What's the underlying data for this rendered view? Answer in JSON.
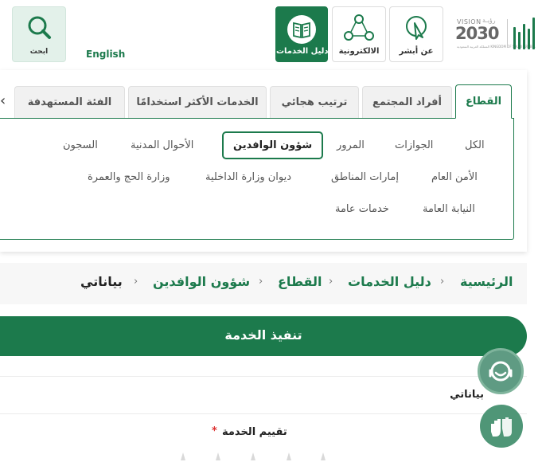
{
  "header": {
    "logo": {
      "vision_en": "VISION",
      "vision_ar": "رؤيـة",
      "year": "2030",
      "ministry": "المملكة العربية السعودية KINGDOM OF SAUDI ARABIA"
    },
    "buttons": [
      {
        "label": "عن أبشر",
        "icon": "pointer-icon"
      },
      {
        "label": "الالكترونية",
        "icon": "share-icon"
      },
      {
        "label": "دليل الخدمات",
        "icon": "book-icon",
        "active": true
      }
    ],
    "search_label": "ابحث",
    "language_link": "English"
  },
  "tabs": [
    {
      "label": "القطاع",
      "active": true
    },
    {
      "label": "أفراد المجتمع"
    },
    {
      "label": "ترتيب هجائي"
    },
    {
      "label": "الخدمات الأكثر استخدامًا"
    },
    {
      "label": "الفئة المستهدفة"
    }
  ],
  "categories": {
    "row1": [
      "الكل",
      "الجوازات",
      "المرور",
      "شؤون الوافدين",
      "الأحوال المدنية",
      "السجون"
    ],
    "row2": [
      "الأمن العام",
      "إمارات المناطق",
      "ديوان وزارة الداخلية",
      "وزارة الحج والعمرة"
    ],
    "row3": [
      "النيابة العامة",
      "خدمات عامة"
    ],
    "active": "شؤون الوافدين"
  },
  "breadcrumb": [
    "الرئيسية",
    "دليل الخدمات",
    "القطاع",
    "شؤون الوافدين",
    "بياناتي"
  ],
  "service": {
    "section_title": "تنفيذ الخدمة",
    "name": "بياناتي",
    "rating_label": "تقييم الخدمة",
    "required_mark": "*",
    "stars": 5
  },
  "colors": {
    "brand": "#1c7a4c",
    "required": "#dd3333"
  }
}
